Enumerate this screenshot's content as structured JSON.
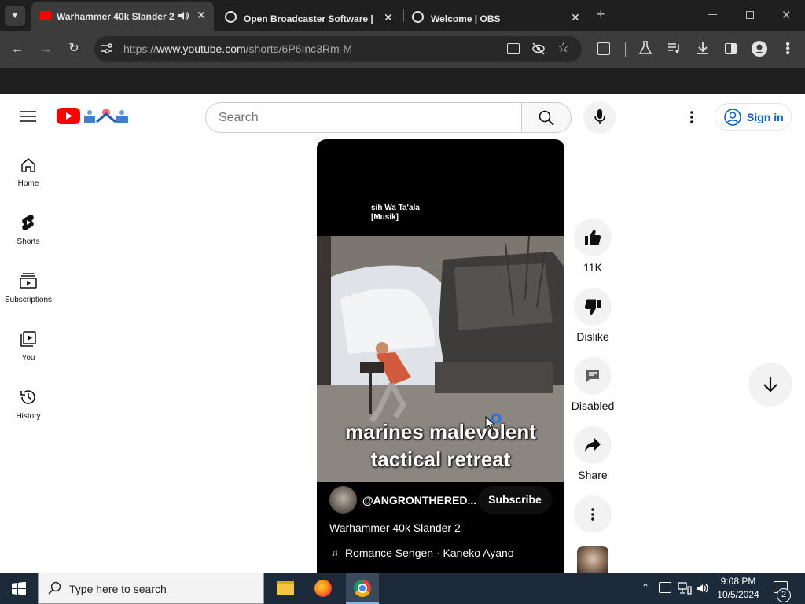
{
  "browser": {
    "tabs": [
      {
        "title": "Warhammer 40k Slander 2",
        "active": true,
        "audio": true
      },
      {
        "title": "Open Broadcaster Software | O",
        "active": false
      },
      {
        "title": "Welcome | OBS",
        "active": false
      }
    ],
    "url_prefix": "https://",
    "url_domain": "www.youtube.com",
    "url_path": "/shorts/6P6Inc3Rm-M",
    "new_tab_symbol": "+"
  },
  "youtube": {
    "search_placeholder": "Search",
    "signin_label": "Sign in",
    "nav": [
      {
        "label": "Home",
        "icon": "home-icon"
      },
      {
        "label": "Shorts",
        "icon": "shorts-icon"
      },
      {
        "label": "Subscriptions",
        "icon": "subscriptions-icon"
      },
      {
        "label": "You",
        "icon": "you-icon"
      },
      {
        "label": "History",
        "icon": "history-icon"
      }
    ],
    "short": {
      "header_line1": "sih Wa Ta'ala",
      "header_line2": "[Musik]",
      "caption_line1": "marines malevolent",
      "caption_line2": "tactical retreat",
      "channel": "@ANGRONTHERED...",
      "subscribe_label": "Subscribe",
      "title": "Warhammer 40k Slander 2",
      "music": "Romance Sengen · Kaneko Ayano"
    },
    "actions": {
      "like_count": "11K",
      "dislike_label": "Dislike",
      "comments_label": "Disabled",
      "share_label": "Share"
    }
  },
  "taskbar": {
    "search_placeholder": "Type here to search",
    "time": "9:08 PM",
    "date": "10/5/2024",
    "notification_count": "2"
  },
  "colors": {
    "yt_red": "#ff0000",
    "yt_blue": "#065fd4",
    "chrome_dark": "#1f1f1f",
    "chrome_toolbar": "#3c3c3c",
    "taskbar": "#1c2a3a"
  }
}
